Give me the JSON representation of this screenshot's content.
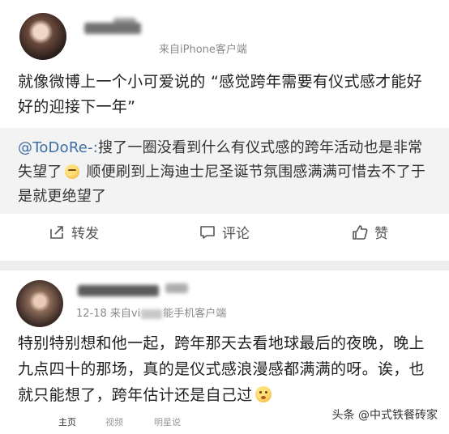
{
  "post1": {
    "meta": "来自iPhone客户端",
    "text": "就像微博上一个小可爱说的 “感觉跨年需要有仪式感才能好好的迎接下一年”",
    "repost": {
      "user": "@ToDoRe-:",
      "text_a": "搜了一圈没看到什么有仪式感的跨年活动也是非常失望了",
      "text_b": " 顺便刷到上海迪士尼圣诞节氛围感满满可惜去不了于是就更绝望了"
    },
    "actions": {
      "repost_label": "转发",
      "comment_label": "评论",
      "like_label": "赞"
    }
  },
  "post2": {
    "meta_date": "12-18",
    "meta_from": "来自vi",
    "meta_client": "能手机客户端",
    "text": "特别特别想和他一起，跨年那天去看地球最后的夜晚，晚上九点四十的那场，真的是仪式感浪漫感都满满的呀。诶，也就只能想了，跨年估计还是自己过"
  },
  "tabbar": {
    "home": "主页",
    "video": "视频",
    "star": "明星说"
  },
  "watermark": "头条 @中式铁餐砖家"
}
